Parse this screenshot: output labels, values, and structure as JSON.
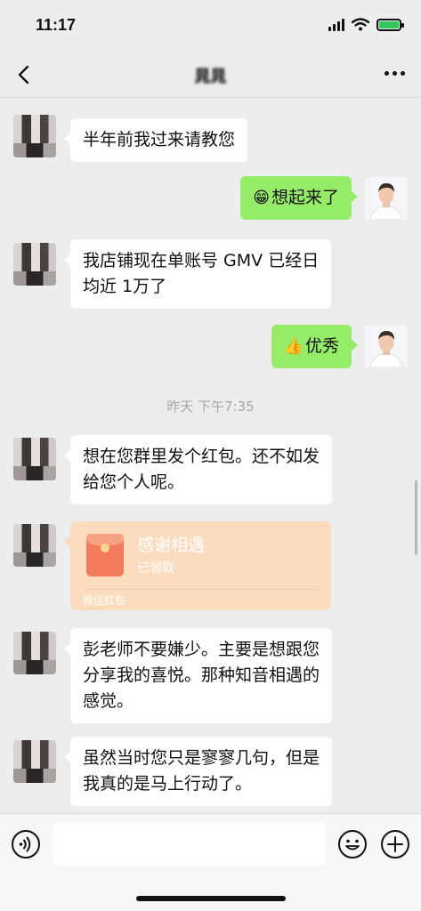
{
  "status_bar": {
    "time": "11:17"
  },
  "nav": {
    "title": "晁晁"
  },
  "messages": [
    {
      "side": "in",
      "text": "半年前我过来请教您"
    },
    {
      "side": "out",
      "emoji": "😁",
      "text": "想起来了"
    },
    {
      "side": "in",
      "lines": [
        "我店铺现在单账号 GMV 已经日",
        "均近 1万了"
      ]
    },
    {
      "side": "out",
      "emoji": "👍",
      "text": "优秀"
    },
    {
      "side": "in",
      "lines": [
        "想在您群里发个红包。还不如发",
        "给您个人呢。"
      ]
    },
    {
      "side": "in",
      "lines": [
        "彭老师不要嫌少。主要是想跟您",
        "分享我的喜悦。那种知音相遇的",
        "感觉。"
      ]
    },
    {
      "side": "in",
      "lines": [
        "虽然当时您只是寥寥几句，但是",
        "我真的是马上行动了。"
      ]
    }
  ],
  "timestamp": "昨天 下午7:35",
  "red_packet": {
    "title": "感谢相遇",
    "status": "已领取",
    "footer": "微信红包",
    "color": "#fbdcbf"
  },
  "input": {
    "value": "",
    "placeholder": ""
  },
  "icons": {
    "back": "chevron-left-icon",
    "more": "more-dots-icon",
    "voice": "voice-icon",
    "emoji": "emoji-icon",
    "plus": "plus-icon"
  },
  "colors": {
    "background": "#ededed",
    "outgoing_bubble": "#95ec69",
    "incoming_bubble": "#ffffff"
  }
}
